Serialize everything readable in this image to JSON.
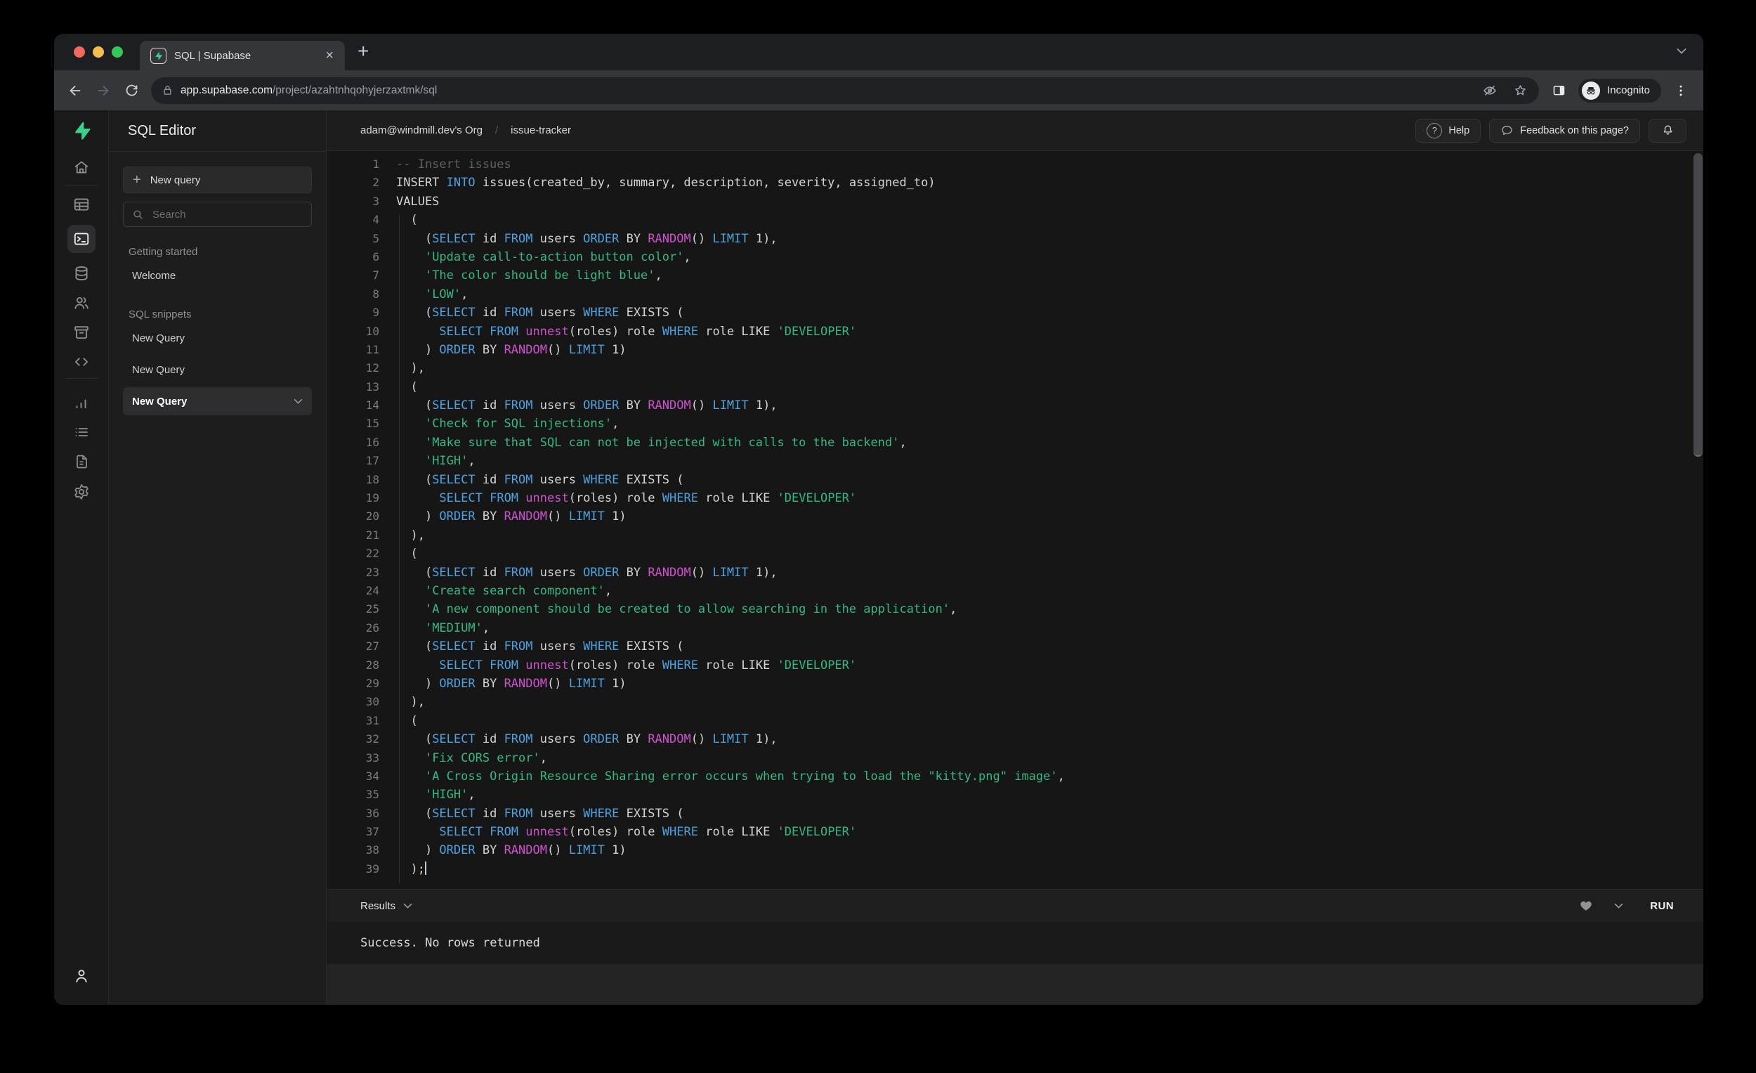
{
  "tab": {
    "title": "SQL | Supabase",
    "close_glyph": "×",
    "new_tab_glyph": "+"
  },
  "toolbar": {
    "url_host": "app.supabase.com",
    "url_path": "/project/azahtnhqohyjerzaxtmk/sql",
    "incognito_label": "Incognito"
  },
  "rail": {
    "items": [
      "supabase-logo",
      "home",
      "table-editor",
      "sql-editor",
      "database",
      "authentication",
      "storage",
      "api",
      "reports",
      "logs",
      "docs",
      "settings",
      "account"
    ],
    "active": "sql-editor"
  },
  "panel": {
    "title": "SQL Editor",
    "new_query_label": "New query",
    "new_query_icon": "+",
    "search_placeholder": "Search",
    "sections": [
      {
        "label": "Getting started",
        "items": [
          {
            "label": "Welcome"
          }
        ]
      },
      {
        "label": "SQL snippets",
        "items": [
          {
            "label": "New Query"
          },
          {
            "label": "New Query"
          },
          {
            "label": "New Query",
            "active": true
          }
        ]
      }
    ]
  },
  "header": {
    "breadcrumb_org": "adam@windmill.dev's Org",
    "breadcrumb_sep": "/",
    "breadcrumb_project": "issue-tracker",
    "help_icon_glyph": "?",
    "help_label": "Help",
    "feedback_label": "Feedback on this page?"
  },
  "results": {
    "label": "Results",
    "run_label": "RUN",
    "message": "Success. No rows returned"
  },
  "colors": {
    "brand_green": "#3ecf8e",
    "keyword": "#4fa1df",
    "function": "#cf52cf",
    "string": "#36b980",
    "comment": "#5f5f5f",
    "text": "#d4d4d4",
    "line_number": "#7c7c80"
  },
  "editor": {
    "lines": [
      {
        "n": 1,
        "t": [
          [
            "c",
            "-- Insert issues"
          ]
        ]
      },
      {
        "n": 2,
        "t": [
          [
            "p",
            "INSERT "
          ],
          [
            "k",
            "INTO"
          ],
          [
            "p",
            " issues(created_by, summary, description, severity, assigned_to)"
          ]
        ]
      },
      {
        "n": 3,
        "t": [
          [
            "p",
            "VALUES"
          ]
        ]
      },
      {
        "n": 4,
        "t": [
          [
            "p",
            "  ("
          ]
        ]
      },
      {
        "n": 5,
        "t": [
          [
            "p",
            "    ("
          ],
          [
            "k",
            "SELECT"
          ],
          [
            "p",
            " id "
          ],
          [
            "k",
            "FROM"
          ],
          [
            "p",
            " users "
          ],
          [
            "k",
            "ORDER"
          ],
          [
            "p",
            " BY "
          ],
          [
            "f",
            "RANDOM"
          ],
          [
            "p",
            "() "
          ],
          [
            "k",
            "LIMIT"
          ],
          [
            "p",
            " 1),"
          ]
        ]
      },
      {
        "n": 6,
        "t": [
          [
            "p",
            "    "
          ],
          [
            "s",
            "'Update call-to-action button color'"
          ],
          [
            "p",
            ","
          ]
        ]
      },
      {
        "n": 7,
        "t": [
          [
            "p",
            "    "
          ],
          [
            "s",
            "'The color should be light blue'"
          ],
          [
            "p",
            ","
          ]
        ]
      },
      {
        "n": 8,
        "t": [
          [
            "p",
            "    "
          ],
          [
            "s",
            "'LOW'"
          ],
          [
            "p",
            ","
          ]
        ]
      },
      {
        "n": 9,
        "t": [
          [
            "p",
            "    ("
          ],
          [
            "k",
            "SELECT"
          ],
          [
            "p",
            " id "
          ],
          [
            "k",
            "FROM"
          ],
          [
            "p",
            " users "
          ],
          [
            "k",
            "WHERE"
          ],
          [
            "p",
            " EXISTS ("
          ]
        ]
      },
      {
        "n": 10,
        "t": [
          [
            "p",
            "      "
          ],
          [
            "k",
            "SELECT"
          ],
          [
            "p",
            " "
          ],
          [
            "k",
            "FROM"
          ],
          [
            "p",
            " "
          ],
          [
            "f",
            "unnest"
          ],
          [
            "p",
            "(roles) role "
          ],
          [
            "k",
            "WHERE"
          ],
          [
            "p",
            " role LIKE "
          ],
          [
            "s",
            "'DEVELOPER'"
          ]
        ]
      },
      {
        "n": 11,
        "t": [
          [
            "p",
            "    ) "
          ],
          [
            "k",
            "ORDER"
          ],
          [
            "p",
            " BY "
          ],
          [
            "f",
            "RANDOM"
          ],
          [
            "p",
            "() "
          ],
          [
            "k",
            "LIMIT"
          ],
          [
            "p",
            " 1)"
          ]
        ]
      },
      {
        "n": 12,
        "t": [
          [
            "p",
            "  ),"
          ]
        ]
      },
      {
        "n": 13,
        "t": [
          [
            "p",
            "  ("
          ]
        ]
      },
      {
        "n": 14,
        "t": [
          [
            "p",
            "    ("
          ],
          [
            "k",
            "SELECT"
          ],
          [
            "p",
            " id "
          ],
          [
            "k",
            "FROM"
          ],
          [
            "p",
            " users "
          ],
          [
            "k",
            "ORDER"
          ],
          [
            "p",
            " BY "
          ],
          [
            "f",
            "RANDOM"
          ],
          [
            "p",
            "() "
          ],
          [
            "k",
            "LIMIT"
          ],
          [
            "p",
            " 1),"
          ]
        ]
      },
      {
        "n": 15,
        "t": [
          [
            "p",
            "    "
          ],
          [
            "s",
            "'Check for SQL injections'"
          ],
          [
            "p",
            ","
          ]
        ]
      },
      {
        "n": 16,
        "t": [
          [
            "p",
            "    "
          ],
          [
            "s",
            "'Make sure that SQL can not be injected with calls to the backend'"
          ],
          [
            "p",
            ","
          ]
        ]
      },
      {
        "n": 17,
        "t": [
          [
            "p",
            "    "
          ],
          [
            "s",
            "'HIGH'"
          ],
          [
            "p",
            ","
          ]
        ]
      },
      {
        "n": 18,
        "t": [
          [
            "p",
            "    ("
          ],
          [
            "k",
            "SELECT"
          ],
          [
            "p",
            " id "
          ],
          [
            "k",
            "FROM"
          ],
          [
            "p",
            " users "
          ],
          [
            "k",
            "WHERE"
          ],
          [
            "p",
            " EXISTS ("
          ]
        ]
      },
      {
        "n": 19,
        "t": [
          [
            "p",
            "      "
          ],
          [
            "k",
            "SELECT"
          ],
          [
            "p",
            " "
          ],
          [
            "k",
            "FROM"
          ],
          [
            "p",
            " "
          ],
          [
            "f",
            "unnest"
          ],
          [
            "p",
            "(roles) role "
          ],
          [
            "k",
            "WHERE"
          ],
          [
            "p",
            " role LIKE "
          ],
          [
            "s",
            "'DEVELOPER'"
          ]
        ]
      },
      {
        "n": 20,
        "t": [
          [
            "p",
            "    ) "
          ],
          [
            "k",
            "ORDER"
          ],
          [
            "p",
            " BY "
          ],
          [
            "f",
            "RANDOM"
          ],
          [
            "p",
            "() "
          ],
          [
            "k",
            "LIMIT"
          ],
          [
            "p",
            " 1)"
          ]
        ]
      },
      {
        "n": 21,
        "t": [
          [
            "p",
            "  ),"
          ]
        ]
      },
      {
        "n": 22,
        "t": [
          [
            "p",
            "  ("
          ]
        ]
      },
      {
        "n": 23,
        "t": [
          [
            "p",
            "    ("
          ],
          [
            "k",
            "SELECT"
          ],
          [
            "p",
            " id "
          ],
          [
            "k",
            "FROM"
          ],
          [
            "p",
            " users "
          ],
          [
            "k",
            "ORDER"
          ],
          [
            "p",
            " BY "
          ],
          [
            "f",
            "RANDOM"
          ],
          [
            "p",
            "() "
          ],
          [
            "k",
            "LIMIT"
          ],
          [
            "p",
            " 1),"
          ]
        ]
      },
      {
        "n": 24,
        "t": [
          [
            "p",
            "    "
          ],
          [
            "s",
            "'Create search component'"
          ],
          [
            "p",
            ","
          ]
        ]
      },
      {
        "n": 25,
        "t": [
          [
            "p",
            "    "
          ],
          [
            "s",
            "'A new component should be created to allow searching in the application'"
          ],
          [
            "p",
            ","
          ]
        ]
      },
      {
        "n": 26,
        "t": [
          [
            "p",
            "    "
          ],
          [
            "s",
            "'MEDIUM'"
          ],
          [
            "p",
            ","
          ]
        ]
      },
      {
        "n": 27,
        "t": [
          [
            "p",
            "    ("
          ],
          [
            "k",
            "SELECT"
          ],
          [
            "p",
            " id "
          ],
          [
            "k",
            "FROM"
          ],
          [
            "p",
            " users "
          ],
          [
            "k",
            "WHERE"
          ],
          [
            "p",
            " EXISTS ("
          ]
        ]
      },
      {
        "n": 28,
        "t": [
          [
            "p",
            "      "
          ],
          [
            "k",
            "SELECT"
          ],
          [
            "p",
            " "
          ],
          [
            "k",
            "FROM"
          ],
          [
            "p",
            " "
          ],
          [
            "f",
            "unnest"
          ],
          [
            "p",
            "(roles) role "
          ],
          [
            "k",
            "WHERE"
          ],
          [
            "p",
            " role LIKE "
          ],
          [
            "s",
            "'DEVELOPER'"
          ]
        ]
      },
      {
        "n": 29,
        "t": [
          [
            "p",
            "    ) "
          ],
          [
            "k",
            "ORDER"
          ],
          [
            "p",
            " BY "
          ],
          [
            "f",
            "RANDOM"
          ],
          [
            "p",
            "() "
          ],
          [
            "k",
            "LIMIT"
          ],
          [
            "p",
            " 1)"
          ]
        ]
      },
      {
        "n": 30,
        "t": [
          [
            "p",
            "  ),"
          ]
        ]
      },
      {
        "n": 31,
        "t": [
          [
            "p",
            "  ("
          ]
        ]
      },
      {
        "n": 32,
        "t": [
          [
            "p",
            "    ("
          ],
          [
            "k",
            "SELECT"
          ],
          [
            "p",
            " id "
          ],
          [
            "k",
            "FROM"
          ],
          [
            "p",
            " users "
          ],
          [
            "k",
            "ORDER"
          ],
          [
            "p",
            " BY "
          ],
          [
            "f",
            "RANDOM"
          ],
          [
            "p",
            "() "
          ],
          [
            "k",
            "LIMIT"
          ],
          [
            "p",
            " 1),"
          ]
        ]
      },
      {
        "n": 33,
        "t": [
          [
            "p",
            "    "
          ],
          [
            "s",
            "'Fix CORS error'"
          ],
          [
            "p",
            ","
          ]
        ]
      },
      {
        "n": 34,
        "t": [
          [
            "p",
            "    "
          ],
          [
            "s",
            "'A Cross Origin Resource Sharing error occurs when trying to load the \"kitty.png\" image'"
          ],
          [
            "p",
            ","
          ]
        ]
      },
      {
        "n": 35,
        "t": [
          [
            "p",
            "    "
          ],
          [
            "s",
            "'HIGH'"
          ],
          [
            "p",
            ","
          ]
        ]
      },
      {
        "n": 36,
        "t": [
          [
            "p",
            "    ("
          ],
          [
            "k",
            "SELECT"
          ],
          [
            "p",
            " id "
          ],
          [
            "k",
            "FROM"
          ],
          [
            "p",
            " users "
          ],
          [
            "k",
            "WHERE"
          ],
          [
            "p",
            " EXISTS ("
          ]
        ]
      },
      {
        "n": 37,
        "t": [
          [
            "p",
            "      "
          ],
          [
            "k",
            "SELECT"
          ],
          [
            "p",
            " "
          ],
          [
            "k",
            "FROM"
          ],
          [
            "p",
            " "
          ],
          [
            "f",
            "unnest"
          ],
          [
            "p",
            "(roles) role "
          ],
          [
            "k",
            "WHERE"
          ],
          [
            "p",
            " role LIKE "
          ],
          [
            "s",
            "'DEVELOPER'"
          ]
        ]
      },
      {
        "n": 38,
        "t": [
          [
            "p",
            "    ) "
          ],
          [
            "k",
            "ORDER"
          ],
          [
            "p",
            " BY "
          ],
          [
            "f",
            "RANDOM"
          ],
          [
            "p",
            "() "
          ],
          [
            "k",
            "LIMIT"
          ],
          [
            "p",
            " 1)"
          ]
        ]
      },
      {
        "n": 39,
        "t": [
          [
            "p",
            "  );"
          ]
        ],
        "cursor": true
      }
    ]
  }
}
